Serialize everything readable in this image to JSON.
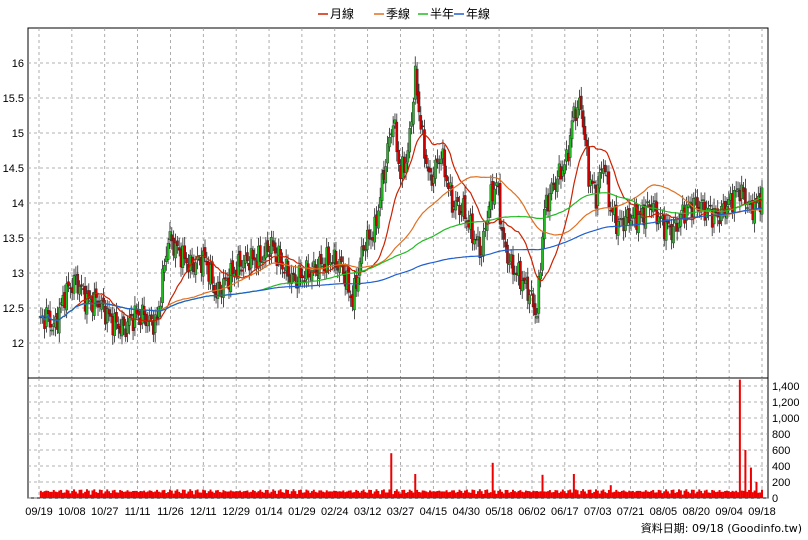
{
  "chart_data": [
    {
      "type": "candlestick",
      "legend": [
        {
          "label": "月線",
          "color": "#cc2200"
        },
        {
          "label": "季線",
          "color": "#e07020"
        },
        {
          "label": "半年",
          "color": "#22bb22"
        },
        {
          "label": "年線",
          "color": "#1f5fd0"
        }
      ],
      "ylim": [
        11.5,
        16.5
      ],
      "yticks": [
        "12",
        "12.5",
        "13",
        "13.5",
        "14",
        "14.5",
        "15",
        "15.5",
        "16"
      ],
      "up_color": "#22bb22",
      "down_color": "#cc0000",
      "grid": true
    },
    {
      "type": "bar",
      "ylim": [
        0,
        1500
      ],
      "yticks": [
        "0",
        "200",
        "400",
        "600",
        "800",
        "1,000",
        "1,200",
        "1,400"
      ],
      "color": "#ee0000"
    }
  ],
  "xaxis": {
    "labels": [
      "09/19",
      "10/08",
      "10/27",
      "11/11",
      "11/26",
      "12/11",
      "12/29",
      "01/14",
      "01/29",
      "02/24",
      "03/12",
      "03/27",
      "04/15",
      "04/30",
      "05/18",
      "06/02",
      "06/17",
      "07/03",
      "07/21",
      "08/05",
      "08/20",
      "09/04",
      "09/18"
    ]
  },
  "footer": {
    "source": "資料日期: 09/18  (Goodinfo.tw)"
  }
}
